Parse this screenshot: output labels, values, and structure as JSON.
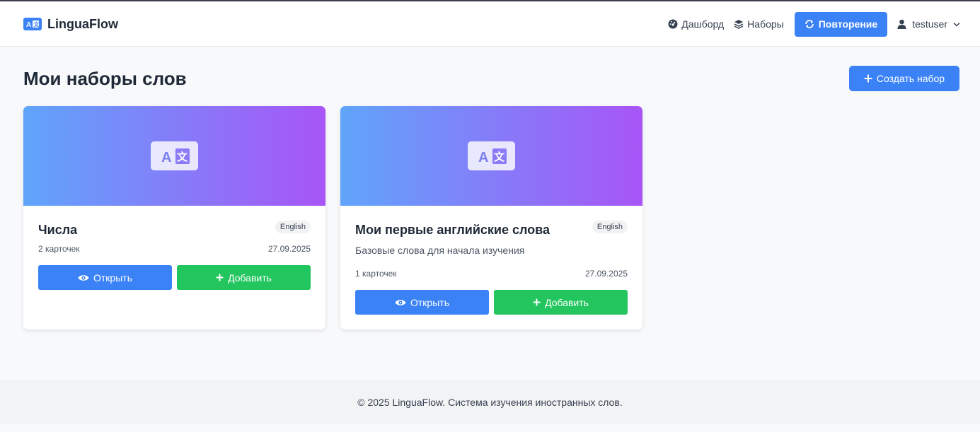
{
  "header": {
    "brand": "LinguaFlow",
    "nav": {
      "dashboard": "Дашборд",
      "sets": "Наборы",
      "review": "Повторение"
    },
    "user": "testuser"
  },
  "main": {
    "title": "Мои наборы слов",
    "create_label": "Создать набор",
    "cards": [
      {
        "title": "Числа",
        "language": "English",
        "description": "",
        "count": "2 карточек",
        "date": "27.09.2025",
        "open_label": "Открыть",
        "add_label": "Добавить"
      },
      {
        "title": "Мои первые английские слова",
        "language": "English",
        "description": "Базовые слова для начала изучения",
        "count": "1 карточек",
        "date": "27.09.2025",
        "open_label": "Открыть",
        "add_label": "Добавить"
      }
    ]
  },
  "footer": {
    "text": "© 2025 LinguaFlow. Система изучения иностранных слов."
  },
  "colors": {
    "primary": "#3b82f6",
    "success": "#22c55e",
    "gradient_start": "#60a5fa",
    "gradient_end": "#a855f7"
  },
  "icons": [
    "language-icon",
    "dashboard-icon",
    "layers-icon",
    "repeat-icon",
    "user-icon",
    "chevron-down-icon",
    "plus-icon",
    "eye-icon"
  ]
}
